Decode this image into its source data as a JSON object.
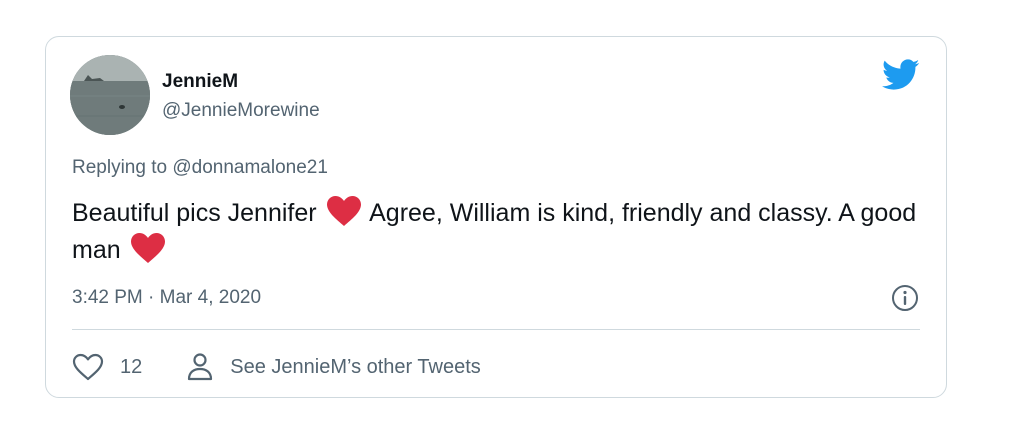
{
  "author": {
    "display_name": "JennieM",
    "handle": "@JennieMorewine"
  },
  "reply": {
    "prefix": "Replying to",
    "mention": "@donnamalone21"
  },
  "tweet": {
    "text_part1": "Beautiful pics Jennifer",
    "text_part2": "Agree, William is kind, friendly and classy. A good man",
    "emoji": "red-heart",
    "timestamp": "3:42 PM · Mar 4, 2020"
  },
  "actions": {
    "like_count": "12",
    "profile_label": "See JennieM’s other Tweets"
  },
  "icons": {
    "brand": "twitter-bird-icon",
    "info": "info-icon",
    "like": "heart-outline-icon",
    "profile": "person-icon"
  },
  "colors": {
    "brand": "#1d9bf0",
    "heart_emoji": "#dd2e44",
    "secondary_text": "#536471",
    "primary_text": "#0f1419",
    "border": "#cfd9de"
  }
}
